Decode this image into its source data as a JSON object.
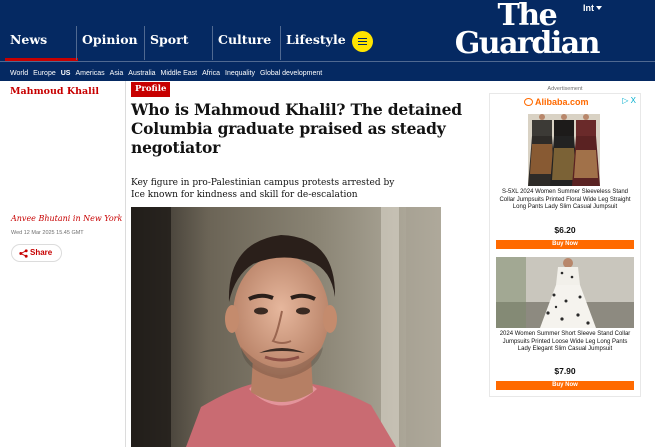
{
  "header": {
    "edition_label": "Int",
    "logo_line1": "The",
    "logo_line2": "Guardian",
    "pillars": [
      {
        "label": "News",
        "active": true
      },
      {
        "label": "Opinion",
        "active": false
      },
      {
        "label": "Sport",
        "active": false
      },
      {
        "label": "Culture",
        "active": false
      },
      {
        "label": "Lifestyle",
        "active": false
      }
    ],
    "menu_icon": "hamburger-menu-icon",
    "subnav": [
      {
        "label": "World",
        "bold": false
      },
      {
        "label": "Europe",
        "bold": false
      },
      {
        "label": "US",
        "bold": true
      },
      {
        "label": "Americas",
        "bold": false
      },
      {
        "label": "Asia",
        "bold": false
      },
      {
        "label": "Australia",
        "bold": false
      },
      {
        "label": "Middle East",
        "bold": false
      },
      {
        "label": "Africa",
        "bold": false
      },
      {
        "label": "Inequality",
        "bold": false
      },
      {
        "label": "Global development",
        "bold": false
      }
    ]
  },
  "article": {
    "series": "Mahmoud Khalil",
    "tag": "Profile",
    "headline": "Who is Mahmoud Khalil? The detained Columbia graduate praised as steady negotiator",
    "standfirst": "Key figure in pro-Palestinian campus protests arrested by Ice known for kindness and skill for de-escalation",
    "byline": "Anvee Bhutani in New York",
    "date": "Wed 12 Mar 2025 15.45 GMT",
    "share_label": "Share"
  },
  "ad": {
    "label": "Advertisement",
    "brand": "Alibaba.com",
    "close_label": "▷ X",
    "products": [
      {
        "title": "S-5XL 2024 Women Summer Sleeveless Stand Collar Jumpsuits Printed Floral Wide Leg Straight Long Pants Lady Slim Casual Jumpsuit",
        "price": "$6.20",
        "cta": "Buy Now"
      },
      {
        "title": "2024 Women Summer Short Sleeve Stand Collar Jumpsuits Printed Loose Wide Leg Long Pants Lady Elegant Slim Casual Jumpsuit",
        "price": "$7.90",
        "cta": "Buy Now"
      }
    ]
  },
  "colors": {
    "brand_navy": "#052962",
    "news_red": "#c70000",
    "menu_yellow": "#ffe500",
    "ad_orange": "#ff6a00"
  }
}
